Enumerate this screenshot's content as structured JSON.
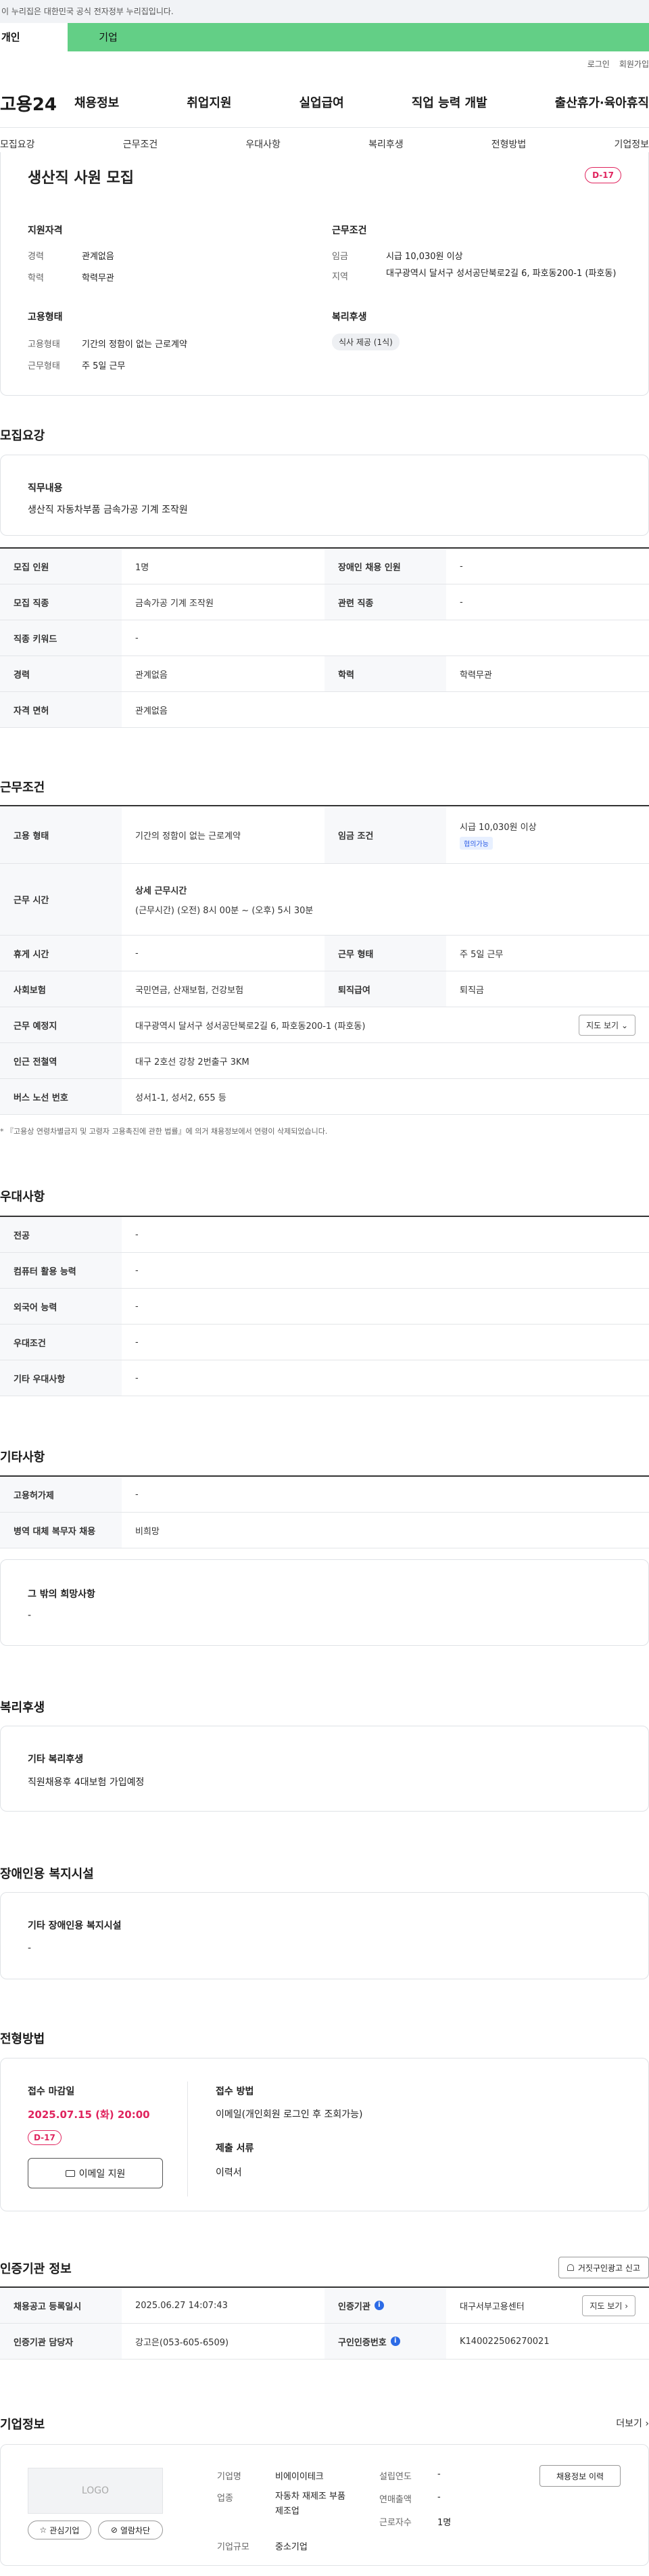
{
  "topbar": {
    "notice": "이 누리집은 대한민국 공식 전자정부 누리집입니다."
  },
  "usertabs": {
    "personal": "개인",
    "company": "기업"
  },
  "util": {
    "login": "로그인",
    "join": "회원가입"
  },
  "header": {
    "logo": "고용24",
    "gnb": [
      "채용정보",
      "취업지원",
      "실업급여",
      "직업 능력 개발",
      "출산휴가·육아휴직"
    ]
  },
  "snb": [
    "모집요강",
    "근무조건",
    "우대사항",
    "복리후생",
    "전형방법",
    "기업정보"
  ],
  "job": {
    "title": "생산직 사원 모집",
    "dday": "D-17"
  },
  "summary": {
    "qual_title": "지원자격",
    "cond_title": "근무조건",
    "career_label": "경력",
    "career_val": "관계없음",
    "edu_label": "학력",
    "edu_val": "학력무관",
    "wage_label": "임금",
    "wage_val": "시급 10,030원 이상",
    "area_label": "지역",
    "area_val": "대구광역시 달서구 성서공단북로2길 6, 파호동200-1 (파호동)",
    "emp_title": "고용형태",
    "welfare_title": "복리후생",
    "emp_label": "고용형태",
    "emp_val": "기간의 정함이 없는 근로계약",
    "work_label": "근무형태",
    "work_val": "주 5일 근무",
    "welfare_chip": "식사 제공 (1식)"
  },
  "recruit": {
    "title": "모집요강",
    "duty_title": "직무내용",
    "duty_val": "생산직 자동차부품 금속가공 기계 조작원",
    "rows": [
      {
        "l1": "모집 인원",
        "v1": "1명",
        "l2": "장애인 채용 인원",
        "v2": "-"
      },
      {
        "l1": "모집 직종",
        "v1": "금속가공 기계 조작원",
        "l2": "관련 직종",
        "v2": "-"
      },
      {
        "l1": "직종 키워드",
        "v1": "-"
      },
      {
        "l1": "경력",
        "v1": "관계없음",
        "l2": "학력",
        "v2": "학력무관"
      },
      {
        "l1": "자격 면허",
        "v1": "관계없음"
      }
    ]
  },
  "cond": {
    "title": "근무조건",
    "emp_l": "고용 형태",
    "emp_v": "기간의 정함이 없는 근로계약",
    "wage_l": "임금 조건",
    "wage_v": "시급 10,030원 이상",
    "wage_tag": "협의가능",
    "time_l": "근무 시간",
    "time_title": "상세 근무시간",
    "time_v": "(근무시간) (오전) 8시 00분 ~ (오후) 5시 30분",
    "rest_l": "휴게 시간",
    "rest_v": "-",
    "type_l": "근무 형태",
    "type_v": "주 5일 근무",
    "ins_l": "사회보험",
    "ins_v": "국민연금, 산재보험, 건강보험",
    "ret_l": "퇴직급여",
    "ret_v": "퇴직금",
    "place_l": "근무 예정지",
    "place_v": "대구광역시 달서구 성서공단북로2길 6, 파호동200-1 (파호동)",
    "map_btn": "지도 보기",
    "sub_l": "인근 전철역",
    "sub_v": "대구 2호선 강창 2번출구 3KM",
    "bus_l": "버스 노선 번호",
    "bus_v": "성서1-1, 성서2, 655 등",
    "note": "* 『고용상 연령차별금지 및 고령자 고용촉진에 관한 법률』에 의거 채용정보에서 연령이 삭제되었습니다."
  },
  "pref": {
    "title": "우대사항",
    "rows": [
      {
        "l": "전공",
        "v": "-"
      },
      {
        "l": "컴퓨터 활용 능력",
        "v": "-"
      },
      {
        "l": "외국어 능력",
        "v": "-"
      },
      {
        "l": "우대조건",
        "v": "-"
      },
      {
        "l": "기타 우대사항",
        "v": "-"
      }
    ]
  },
  "etc": {
    "title": "기타사항",
    "rows": [
      {
        "l": "고용허가제",
        "v": "-"
      },
      {
        "l": "병역 대체 복무자 채용",
        "v": "비희망"
      }
    ],
    "hope_title": "그 밖의 희망사항",
    "hope_v": "-"
  },
  "welfare": {
    "title": "복리후생",
    "box_title": "기타 복리후생",
    "box_v": "직원채용후 4대보험 가입예정"
  },
  "disab": {
    "title": "장애인용 복지시설",
    "box_title": "기타 장애인용 복지시설",
    "box_v": "-"
  },
  "screen": {
    "title": "전형방법",
    "deadline_l": "접수 마감일",
    "deadline_v": "2025.07.15 (화) 20:00",
    "dday": "D-17",
    "email_btn": "이메일 지원",
    "method_l": "접수 방법",
    "method_v": "이메일(개인회원 로그인 후 조회가능)",
    "docs_l": "제출 서류",
    "docs_v": "이력서"
  },
  "cert": {
    "title": "인증기관 정보",
    "report_btn": "거짓구인광고 신고",
    "reg_l": "채용공고 등록일시",
    "reg_v": "2025.06.27 14:07:43",
    "org_l": "인증기관",
    "org_v": "대구서부고용센터",
    "map_btn": "지도 보기",
    "mgr_l": "인증기관 담당자",
    "mgr_v": "강고은(053-605-6509)",
    "no_l": "구인인증번호",
    "no_v": "K140022506270021"
  },
  "company": {
    "title": "기업정보",
    "more": "더보기",
    "logo": "LOGO",
    "fav_btn": "관심기업",
    "block_btn": "열람차단",
    "name_l": "기업명",
    "name_v": "비에이이테크",
    "ind_l": "업종",
    "ind_v": "자동차 재제조 부품 제조업",
    "size_l": "기업규모",
    "size_v": "중소기업",
    "year_l": "설립연도",
    "year_v": "-",
    "sales_l": "연매출액",
    "sales_v": "-",
    "emp_l": "근로자수",
    "emp_v": "1명",
    "history_btn": "채용정보 이력"
  },
  "colors": {
    "green": "#63cf86",
    "accent": "#e0245e",
    "blue": "#2c6be6"
  }
}
